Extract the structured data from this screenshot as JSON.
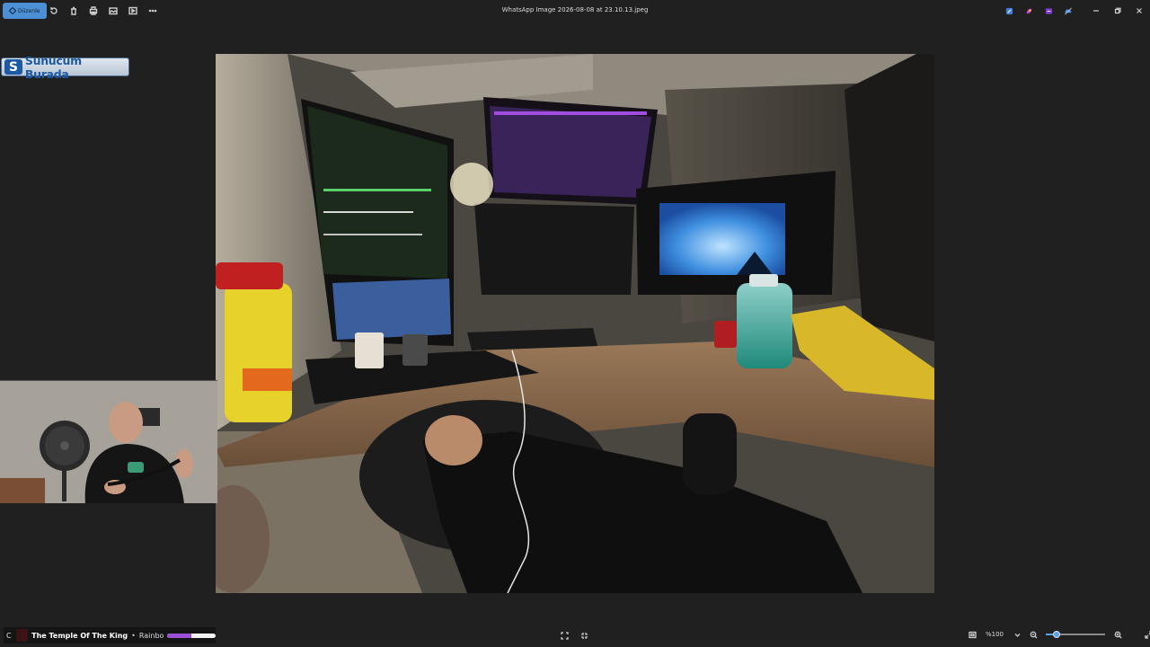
{
  "toolbar": {
    "edit_label": "Düzenle",
    "icons": [
      "rotate-icon",
      "delete-icon",
      "print-icon",
      "gallery-icon",
      "slideshow-icon",
      "more-icon"
    ]
  },
  "window": {
    "title": "WhatsApp Image 2026-08-08 at 23.10.13.jpeg"
  },
  "overlay": {
    "logo_mark": "S",
    "logo_text": "Sunucum Burada"
  },
  "now_playing": {
    "prefix": "C",
    "title": "The Temple Of The King",
    "separator": "•",
    "artist": "Rainbow",
    "progress": 0.5
  },
  "bottom": {
    "zoom_value": "%100",
    "zoom_level": 0.18
  },
  "colors": {
    "accent": "#4c8fd4",
    "progress": "#9b4fd6",
    "logo_blue": "#1d5aa5"
  }
}
